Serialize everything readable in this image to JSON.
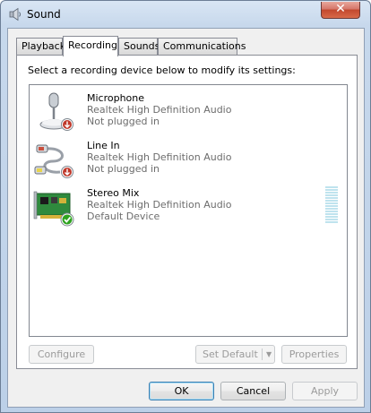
{
  "window": {
    "title": "Sound",
    "close_label": "✕"
  },
  "tabs": [
    {
      "label": "Playback"
    },
    {
      "label": "Recording"
    },
    {
      "label": "Sounds"
    },
    {
      "label": "Communications"
    }
  ],
  "panel": {
    "instruction": "Select a recording device below to modify its settings:"
  },
  "devices": [
    {
      "name": "Microphone",
      "driver": "Realtek High Definition Audio",
      "status": "Not plugged in",
      "icon": "microphone-icon",
      "status_icon": "unplugged-icon"
    },
    {
      "name": "Line In",
      "driver": "Realtek High Definition Audio",
      "status": "Not plugged in",
      "icon": "line-in-cable-icon",
      "status_icon": "unplugged-icon"
    },
    {
      "name": "Stereo Mix",
      "driver": "Realtek High Definition Audio",
      "status": "Default Device",
      "icon": "sound-card-icon",
      "status_icon": "default-checkmark-icon",
      "level": 0
    }
  ],
  "buttons": {
    "configure": "Configure",
    "set_default": "Set Default",
    "properties": "Properties",
    "ok": "OK",
    "cancel": "Cancel",
    "apply": "Apply"
  },
  "colors": {
    "close_red": "#c2482f",
    "default_check_green": "#2ea31f",
    "unplugged_red": "#c0392b"
  }
}
